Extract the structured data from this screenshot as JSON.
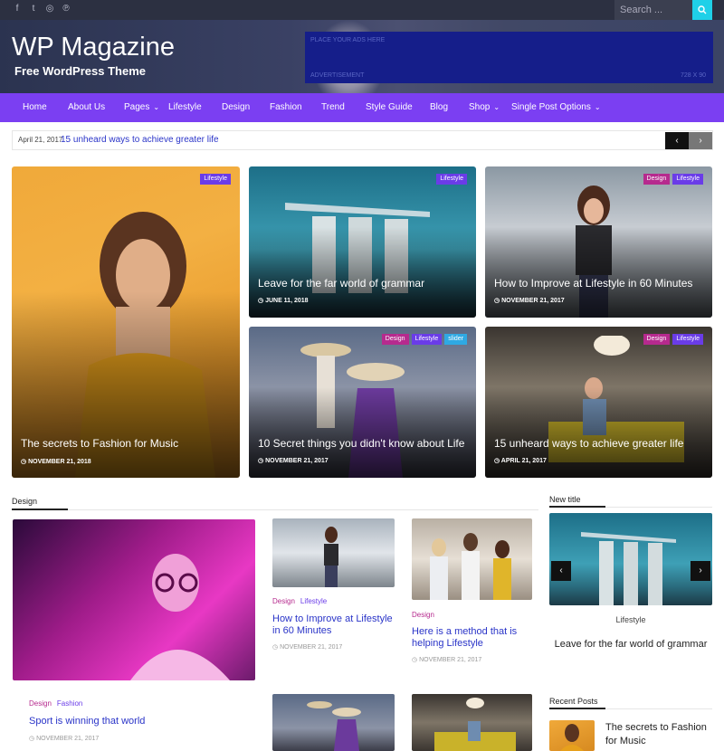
{
  "topbar": {
    "social_icons": [
      "facebook-icon",
      "twitter-icon",
      "instagram-icon",
      "pinterest-icon"
    ],
    "search_placeholder": "Search ..."
  },
  "header": {
    "site_title": "WP Magazine",
    "tagline": "Free WordPress Theme",
    "ad_placeholder": "PLACE YOUR ADS HERE",
    "ad_label": "ADVERTISEMENT",
    "ad_size": "728 X 90"
  },
  "nav": {
    "items": [
      {
        "label": "Home"
      },
      {
        "label": "About Us"
      },
      {
        "label": "Pages"
      },
      {
        "label": "Lifestyle"
      },
      {
        "label": "Design"
      },
      {
        "label": "Fashion"
      },
      {
        "label": "Trend"
      },
      {
        "label": "Style Guide"
      },
      {
        "label": "Blog"
      },
      {
        "label": "Shop"
      },
      {
        "label": "Single Post Options"
      }
    ]
  },
  "ticker": {
    "date": "April 21, 2017",
    "title": "15 unheard ways to achieve greater life",
    "prev": "‹",
    "next": "›"
  },
  "featured": [
    {
      "title": "The secrets to Fashion for Music",
      "date": "NOVEMBER 21, 2018",
      "cats": [
        "Lifestyle"
      ]
    },
    {
      "title": "Leave for the far world of grammar",
      "date": "JUNE 11, 2018",
      "cats": [
        "Lifestyle"
      ]
    },
    {
      "title": "How to Improve at Lifestyle in 60 Minutes",
      "date": "NOVEMBER 21, 2017",
      "cats": [
        "Design",
        "Lifestyle"
      ]
    },
    {
      "title": "10 Secret things you didn't know about Life",
      "date": "NOVEMBER 21, 2017",
      "cats": [
        "Design",
        "Lifestyle",
        "slider"
      ]
    },
    {
      "title": "15 unheard ways to achieve greater life",
      "date": "APRIL 21, 2017",
      "cats": [
        "Design",
        "Lifestyle"
      ]
    }
  ],
  "design_section": {
    "heading": "Design",
    "main_post": {
      "cat1": "Design",
      "cat2": "Fashion",
      "title": "Sport is winning that world",
      "date": "NOVEMBER 21, 2017"
    },
    "post2": {
      "cat1": "Design",
      "cat2": "Lifestyle",
      "title": "How to Improve at Lifestyle in 60 Minutes",
      "date": "NOVEMBER 21, 2017"
    },
    "post3": {
      "cat1": "Design",
      "title": "Here is a method that is helping Lifestyle",
      "date": "NOVEMBER 21, 2017"
    }
  },
  "sidebar": {
    "new_title_heading": "New title",
    "slide_category": "Lifestyle",
    "slide_title": "Leave for the far world of grammar",
    "recent_heading": "Recent Posts",
    "recent_post_title": "The secrets to Fashion for Music"
  },
  "colors": {
    "nav": "#7b3ff2",
    "accent_link": "#2a34c8",
    "cat_lifestyle": "#6a3ce8",
    "cat_design": "#b62a8e",
    "cat_slider": "#2fa9e3",
    "search_btn": "#1fd0e8"
  }
}
